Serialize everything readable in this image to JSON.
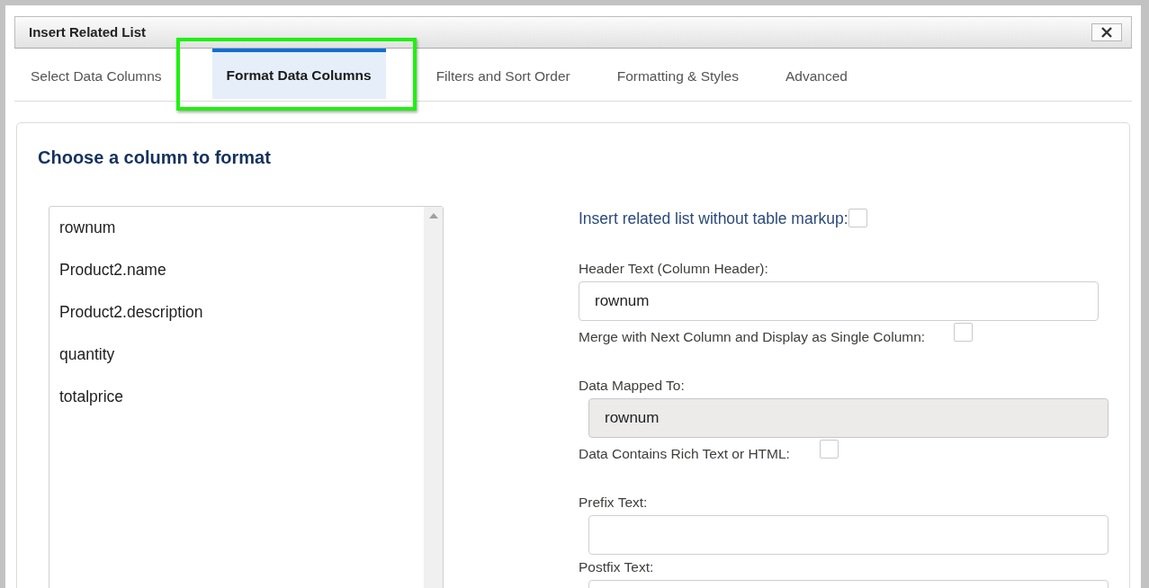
{
  "window": {
    "title": "Insert Related List"
  },
  "tabs": [
    {
      "label": "Select Data Columns",
      "selected": false,
      "highlighted": false
    },
    {
      "label": "Format Data Columns",
      "selected": true,
      "highlighted": true
    },
    {
      "label": "Filters and Sort Order",
      "selected": false,
      "highlighted": false
    },
    {
      "label": "Formatting & Styles",
      "selected": false,
      "highlighted": false
    },
    {
      "label": "Advanced",
      "selected": false,
      "highlighted": false
    }
  ],
  "heading": "Choose a column to format",
  "columns": [
    {
      "label": "rownum",
      "selected": false
    },
    {
      "label": "Product2.name",
      "selected": false
    },
    {
      "label": "Product2.description",
      "selected": false
    },
    {
      "label": "quantity",
      "selected": false
    },
    {
      "label": "totalprice",
      "selected": false
    }
  ],
  "fields": [
    {
      "kind": "option",
      "label": "Insert related list without table markup:",
      "checked": false
    },
    {
      "kind": "text",
      "label": "Header Text (Column Header):",
      "value": "rownum"
    },
    {
      "kind": "checkbox",
      "label": "Merge with Next Column and Display as Single Column:",
      "checked": false
    },
    {
      "kind": "readonly",
      "label": "Data Mapped To:",
      "value": "rownum"
    },
    {
      "kind": "checkbox",
      "label": "Data Contains Rich Text or HTML:",
      "checked": false
    },
    {
      "kind": "text",
      "label": "Prefix Text:"
    },
    {
      "kind": "text",
      "label": "Postfix Text:"
    }
  ]
}
